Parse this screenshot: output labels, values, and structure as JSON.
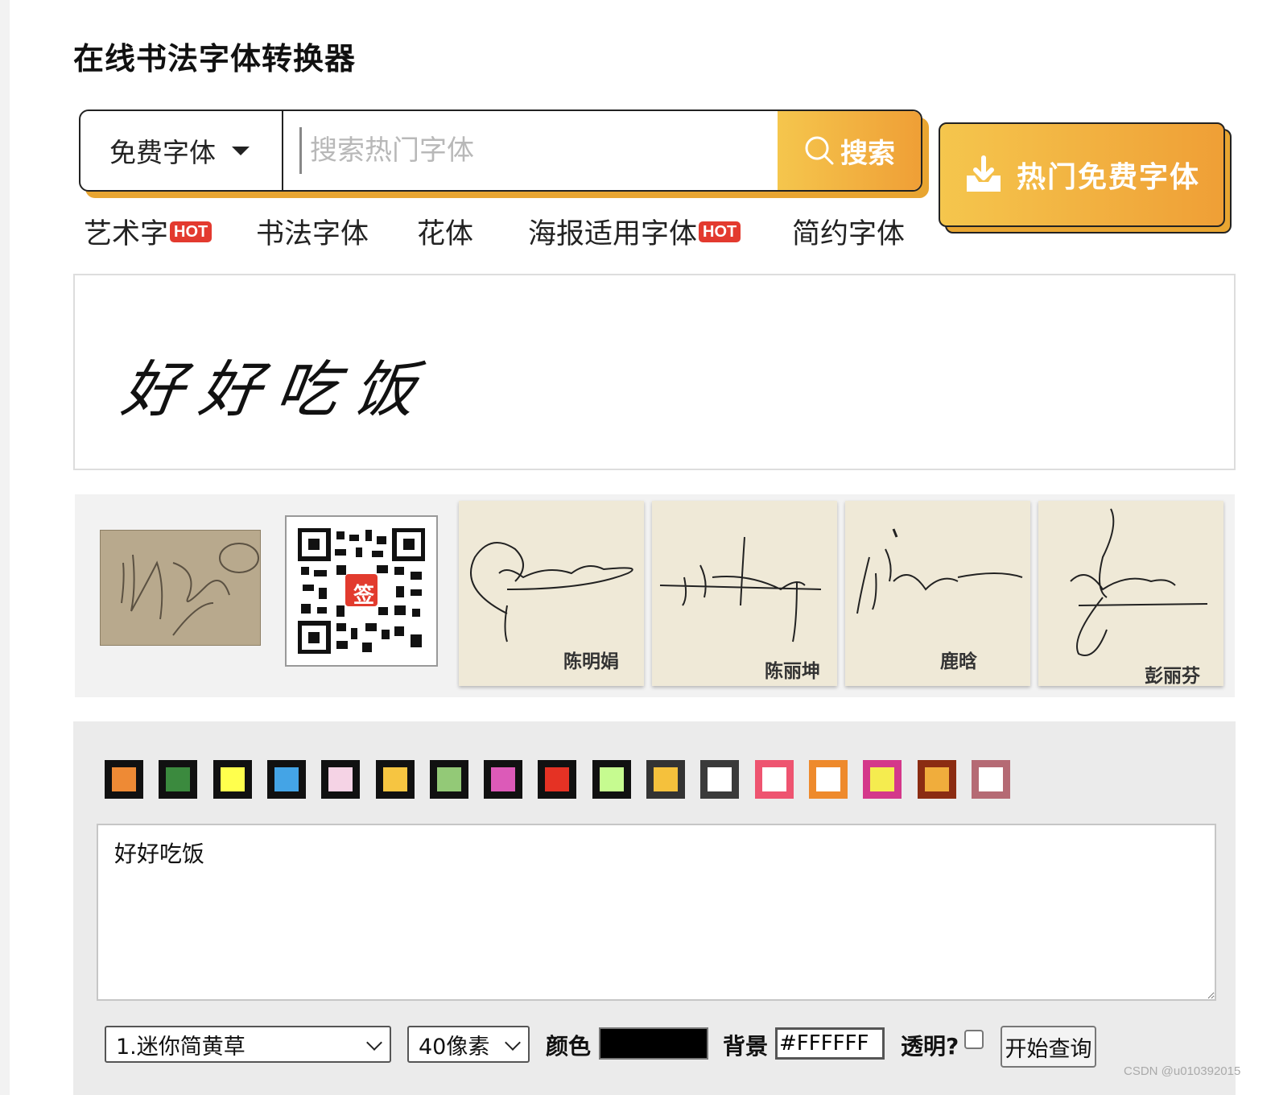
{
  "page": {
    "title": "在线书法字体转换器"
  },
  "search": {
    "category": "免费字体",
    "placeholder": "搜索热门字体",
    "button_label": "搜索"
  },
  "hot_button": {
    "label": "热门免费字体"
  },
  "tabs": [
    {
      "label": "艺术字",
      "badge": "HOT"
    },
    {
      "label": "书法字体",
      "badge": ""
    },
    {
      "label": "花体",
      "badge": ""
    },
    {
      "label": "海报适用字体",
      "badge": "HOT"
    },
    {
      "label": "简约字体",
      "badge": ""
    }
  ],
  "preview": {
    "text": "好好吃饭"
  },
  "ads": {
    "qr_badge": "签",
    "signatures": [
      {
        "name": "陈明娟"
      },
      {
        "name": "陈丽坤"
      },
      {
        "name": "鹿晗"
      },
      {
        "name": "彭丽芬"
      }
    ]
  },
  "colors": {
    "swatches": [
      "#ee8a35",
      "#3b8a3e",
      "#ffff4d",
      "#44a4e6",
      "#f5d3e5",
      "#f6c541",
      "#93c977",
      "#dc5ab8",
      "#e53224",
      "#c6fb90",
      "#f5c13c",
      "#ffffff",
      "#ffffff",
      "#ffffff",
      "#f5ec4f",
      "#f0ad3c",
      "#ffffff"
    ],
    "swatch_borders": [
      "#111111",
      "#111111",
      "#111111",
      "#111111",
      "#111111",
      "#111111",
      "#111111",
      "#111111",
      "#111111",
      "#111111",
      "#333333",
      "#3a3a3a",
      "#ee5470",
      "#ee8a2c",
      "#d4388a",
      "#8b2c12",
      "#b56a74"
    ]
  },
  "form": {
    "text_value": "好好吃饭",
    "font_select": "1.迷你简黄草",
    "size_select": "40像素",
    "color_label": "颜色",
    "color_value": "#000000",
    "background_label": "背景",
    "background_value": "#FFFFFF",
    "transparent_label": "透明?",
    "submit_label": "开始查询"
  },
  "watermark": "CSDN @u010392015"
}
